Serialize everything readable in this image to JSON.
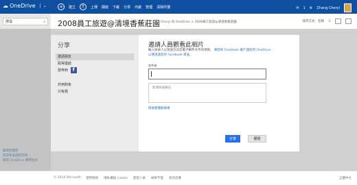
{
  "topbar": {
    "logo": "OneDrive",
    "menu_create": "建立",
    "menu_upload": "上傳",
    "menu_open": "開啟",
    "menu_download": "下載",
    "menu_share": "分享",
    "menu_embed": "內嵌",
    "menu_manage": "管理",
    "menu_clear": "清除所選",
    "notifications_count": "1",
    "user_name": "Zhang Cheryl"
  },
  "sidebar": {
    "search_placeholder": "搜尋",
    "link1": "資源回收筒",
    "link2": "取得更多儲存空間",
    "link3": "取得 OneDrive 應用程式"
  },
  "header": {
    "title": "2008員工旅遊@清境香蕉莊園",
    "breadcrumb": "Cheryl 的 OneDrive > 2008員工旅遊@清境香蕉莊園",
    "sort": "排序方式：名稱"
  },
  "dialog_left": {
    "title": "分享",
    "items": [
      "邀請朋友",
      "取得連結",
      "發佈到",
      "共用對象",
      "只有我"
    ]
  },
  "dialog_right": {
    "title": "邀請人員觀看此相片",
    "description": "輸入接收人以寄送包含您電子郵件文字的項目。",
    "description_link": "將您的 Facebook 帳戶連結到 OneDrive 以便透過您的 Facebook 寄送。",
    "recipient_label": "收件者",
    "note_placeholder": "新增快速筆記",
    "anyone_link": "接收者僅能檢視",
    "share_button": "分享",
    "close_button": "關閉"
  },
  "footer": {
    "copyright": "© 2014 Microsoft",
    "terms": "使用條款",
    "privacy": "隱私權與 Cookie",
    "developers": "開發人員",
    "report": "檢舉不當",
    "feedback": "意見反應",
    "language": "正體中文"
  },
  "colors": {
    "topbar": "#0f4f9f",
    "primary_button": "#2672ec",
    "facebook": "#3b5998",
    "link": "#2f6fb2"
  }
}
